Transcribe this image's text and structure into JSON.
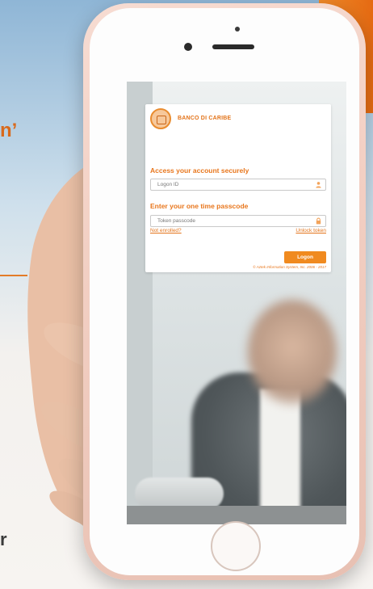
{
  "background": {
    "headline_fragment": "n’",
    "footer_fragment": "r"
  },
  "login": {
    "brand_name": "BANCO DI CARIBE",
    "section_account_title": "Access your account securely",
    "logon_id_placeholder": "Logon ID",
    "section_passcode_title": "Enter your one time passcode",
    "token_placeholder": "Token passcode",
    "not_enrolled_link": "Not enrolled?",
    "unlock_token_link": "Unlock token",
    "logon_button": "Logon",
    "copyright": "© Aztek Information System, Inc. 2006 - 2017"
  },
  "icons": {
    "user": "user-icon",
    "lock": "lock-icon",
    "logo": "bank-logo-icon"
  },
  "colors": {
    "accent": "#e8761c",
    "button": "#f08a1f"
  }
}
